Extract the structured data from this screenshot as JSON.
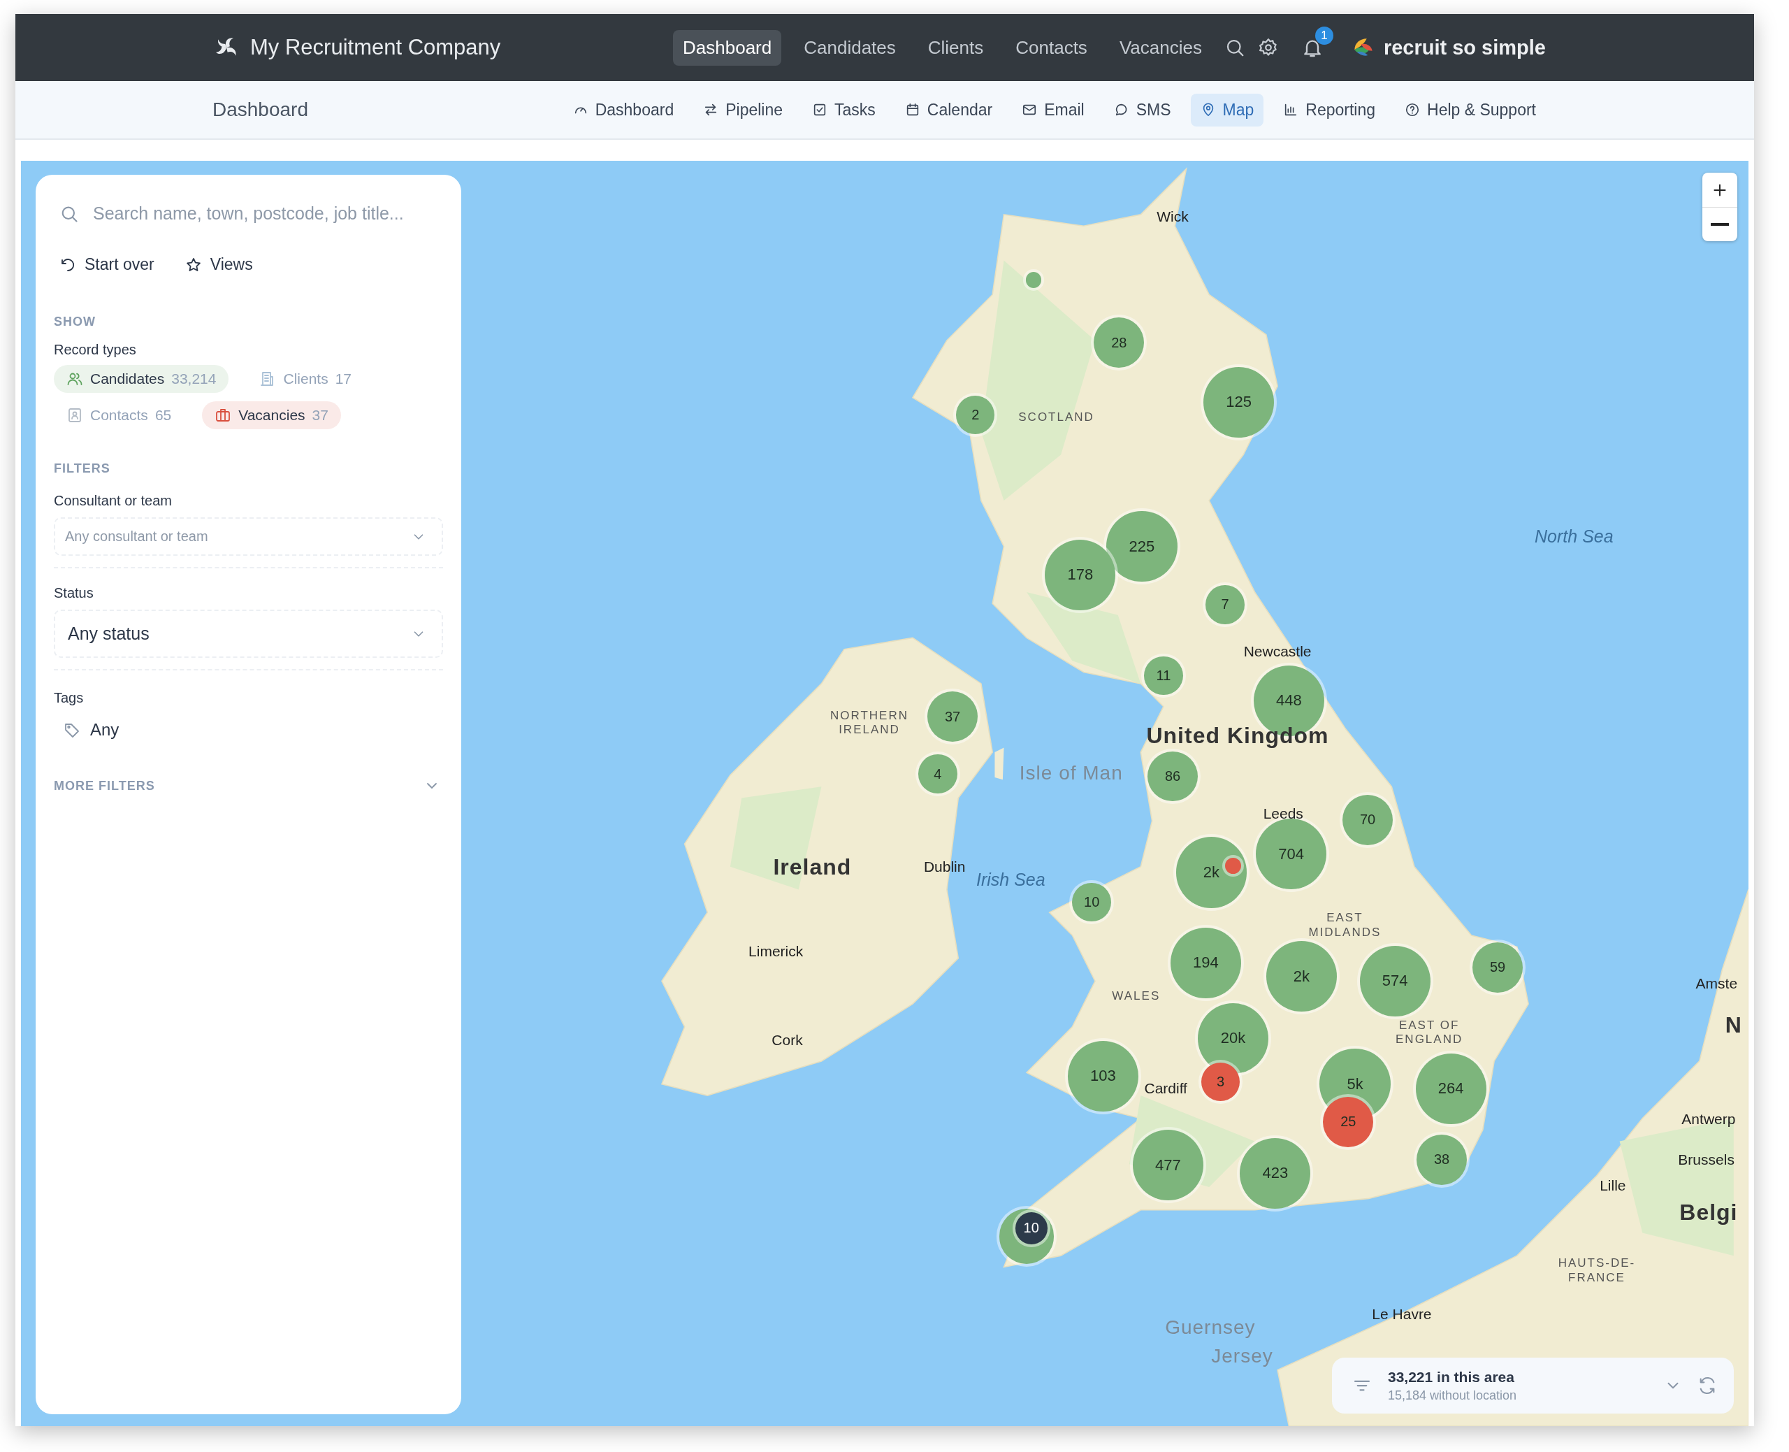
{
  "top_bar": {
    "company": "My Recruitment Company",
    "nav": [
      {
        "label": "Dashboard",
        "selected": true
      },
      {
        "label": "Candidates",
        "selected": false
      },
      {
        "label": "Clients",
        "selected": false
      },
      {
        "label": "Contacts",
        "selected": false
      },
      {
        "label": "Vacancies",
        "selected": false
      }
    ],
    "notification_count": "1",
    "product": "recruit so simple"
  },
  "sub_bar": {
    "title": "Dashboard",
    "tabs": [
      {
        "label": "Dashboard",
        "selected": false
      },
      {
        "label": "Pipeline",
        "selected": false
      },
      {
        "label": "Tasks",
        "selected": false
      },
      {
        "label": "Calendar",
        "selected": false
      },
      {
        "label": "Email",
        "selected": false
      },
      {
        "label": "SMS",
        "selected": false
      },
      {
        "label": "Map",
        "selected": true
      },
      {
        "label": "Reporting",
        "selected": false
      },
      {
        "label": "Help & Support",
        "selected": false
      }
    ]
  },
  "sidebar": {
    "search": {
      "placeholder": "Search name, town, postcode, job title..."
    },
    "actions": [
      "Start over",
      "Views"
    ],
    "show_heading": "SHOW",
    "record_types_label": "Record types",
    "record_types": [
      {
        "label": "Candidates",
        "count": "33,214",
        "selected": true,
        "color": "#5fa35f"
      },
      {
        "label": "Clients",
        "count": "17",
        "selected": false,
        "color": "#a9c0d6"
      },
      {
        "label": "Contacts",
        "count": "65",
        "selected": false,
        "color": "#b4bcc6"
      },
      {
        "label": "Vacancies",
        "count": "37",
        "selected": true,
        "color": "#d9503f"
      }
    ],
    "filters_heading": "FILTERS",
    "filters": [
      {
        "label": "Consultant or team",
        "placeholder": "Any consultant or team"
      },
      {
        "label": "Status",
        "value": "Any status"
      }
    ],
    "tags": {
      "label": "Tags",
      "value": "Any"
    },
    "more_filters": {
      "label": "MORE FILTERS",
      "expanded": false
    }
  },
  "map": {
    "labels": [
      {
        "text": "Wick",
        "kind": "city"
      },
      {
        "text": "SCOTLAND",
        "kind": "region"
      },
      {
        "text": "North Sea",
        "kind": "sea"
      },
      {
        "text": "Newcastle",
        "kind": "city"
      },
      {
        "text": "NORTHERN IRELAND",
        "kind": "region"
      },
      {
        "text": "United Kingdom",
        "kind": "country"
      },
      {
        "text": "Isle of Man",
        "kind": "island"
      },
      {
        "text": "Leeds",
        "kind": "city"
      },
      {
        "text": "Ireland",
        "kind": "country"
      },
      {
        "text": "Dublin",
        "kind": "city"
      },
      {
        "text": "Irish Sea",
        "kind": "sea"
      },
      {
        "text": "Limerick",
        "kind": "city"
      },
      {
        "text": "EAST MIDLANDS",
        "kind": "region"
      },
      {
        "text": "Amste",
        "kind": "city"
      },
      {
        "text": "WALES",
        "kind": "region"
      },
      {
        "text": "EAST OF ENGLAND",
        "kind": "region"
      },
      {
        "text": "N",
        "kind": "country"
      },
      {
        "text": "Cork",
        "kind": "city"
      },
      {
        "text": "Cardiff",
        "kind": "city"
      },
      {
        "text": "Antwerp",
        "kind": "city"
      },
      {
        "text": "Brussels",
        "kind": "city"
      },
      {
        "text": "Lille",
        "kind": "city"
      },
      {
        "text": "Belgi",
        "kind": "country"
      },
      {
        "text": "HAUTS-DE-FRANCE",
        "kind": "region"
      },
      {
        "text": "Le Havre",
        "kind": "city"
      },
      {
        "text": "Guernsey",
        "kind": "island"
      },
      {
        "text": "Jersey",
        "kind": "island"
      }
    ],
    "markers": [
      {
        "color": "#7db57c"
      },
      {
        "count": "28",
        "color": "#7db57c"
      },
      {
        "count": "2",
        "color": "#7db57c"
      },
      {
        "count": "125",
        "color": "#7db57c"
      },
      {
        "count": "225",
        "color": "#7db57c"
      },
      {
        "count": "178",
        "color": "#7db57c"
      },
      {
        "count": "7",
        "color": "#7db57c"
      },
      {
        "count": "11",
        "color": "#7db57c"
      },
      {
        "count": "448",
        "color": "#7db57c"
      },
      {
        "count": "37",
        "color": "#7db57c"
      },
      {
        "count": "4",
        "color": "#7db57c"
      },
      {
        "count": "86",
        "color": "#7db57c"
      },
      {
        "count": "70",
        "color": "#7db57c"
      },
      {
        "count": "704",
        "color": "#7db57c"
      },
      {
        "count": "2k",
        "color": "#7db57c"
      },
      {
        "color": "#e05a47"
      },
      {
        "count": "10",
        "color": "#7db57c"
      },
      {
        "count": "194",
        "color": "#7db57c"
      },
      {
        "count": "59",
        "color": "#7db57c"
      },
      {
        "count": "2k",
        "color": "#7db57c"
      },
      {
        "count": "574",
        "color": "#7db57c"
      },
      {
        "count": "20k",
        "color": "#7db57c"
      },
      {
        "count": "103",
        "color": "#7db57c"
      },
      {
        "count": "3",
        "color": "#e05a47"
      },
      {
        "count": "5k",
        "color": "#7db57c"
      },
      {
        "count": "264",
        "color": "#7db57c"
      },
      {
        "count": "25",
        "color": "#e05a47"
      },
      {
        "count": "477",
        "color": "#7db57c"
      },
      {
        "count": "423",
        "color": "#7db57c"
      },
      {
        "count": "38",
        "color": "#7db57c"
      },
      {
        "color": "#7db57c"
      },
      {
        "count": "10",
        "color": "#2c3a4a"
      }
    ],
    "summary": {
      "title": "33,221 in this area",
      "subtitle": "15,184 without location"
    }
  }
}
